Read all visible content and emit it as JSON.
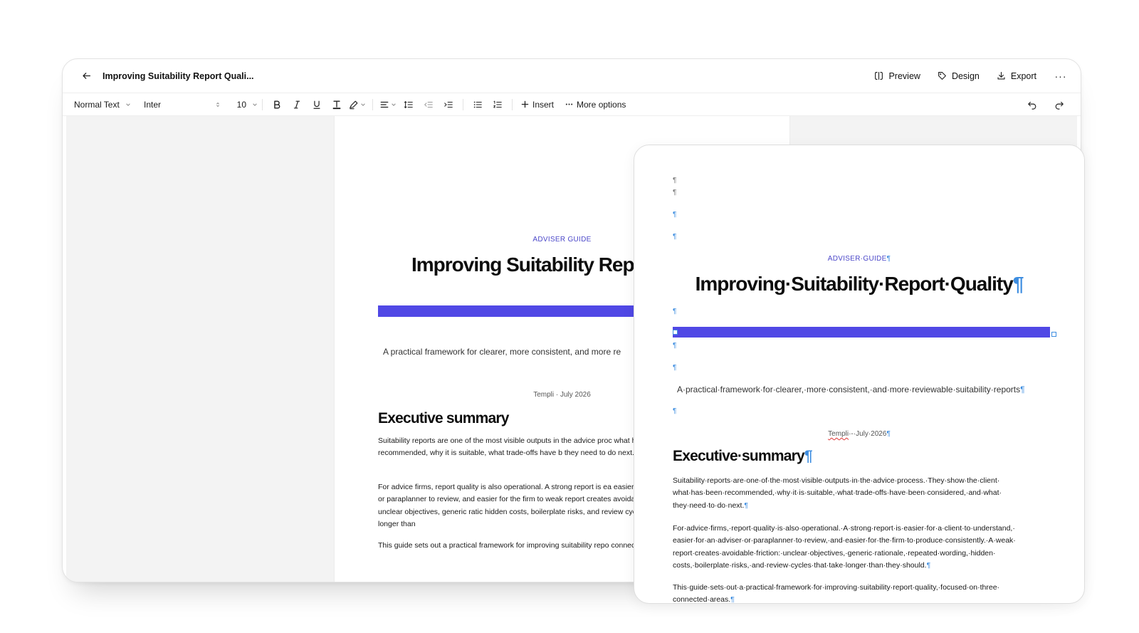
{
  "editor": {
    "doc_title": "Improving Suitability Report Quali...",
    "actions": {
      "preview": "Preview",
      "design": "Design",
      "export": "Export",
      "more": "···"
    },
    "toolbar": {
      "style": "Normal Text",
      "font": "Inter",
      "size": "10",
      "insert": "Insert",
      "more_options": "More options"
    },
    "document": {
      "kicker": "ADVISER GUIDE",
      "title": "Improving Suitability Repo",
      "subtitle": "A practical framework for clearer, more consistent, and more re",
      "byline": "Templi · July 2026",
      "heading": "Executive summary",
      "para1": "Suitability reports are one of the most visible outputs in the advice proc what has been recommended, why it is suitable, what trade-offs have b they need to do next.",
      "para2": "For advice firms, report quality is also operational. A strong report is ea easier for an adviser or paraplanner to review, and easier for the firm to weak report creates avoidable friction: unclear objectives, generic ratic hidden costs, boilerplate risks, and review cycles that take longer than",
      "para3": "This guide sets out a practical framework for improving suitability repo connected areas.",
      "accent_color": "#5048e5"
    }
  },
  "preview_card": {
    "pilcrow": "¶",
    "kicker": "ADVISER·GUIDE",
    "title": "Improving·Suitability·Report·Quality",
    "subtitle": "A·practical·framework·for·clearer,·more·consistent,·and·more·reviewable·suitability·reports",
    "byline_author": "Templi",
    "byline_rest": "·-·July·2026",
    "heading": "Executive·summary",
    "para1": "Suitability·reports·are·one·of·the·most·visible·outputs·in·the·advice·process.·They·show·the·client· what·has·been·recommended,·why·it·is·suitable,·what·trade-offs·have·been·considered,·and·what· they·need·to·do·next.",
    "para2": "For·advice·firms,·report·quality·is·also·operational.·A·strong·report·is·easier·for·a·client·to·understand,· easier·for·an·adviser·or·paraplanner·to·review,·and·easier·for·the·firm·to·produce·consistently.·A·weak· report·creates·avoidable·friction:·unclear·objectives,·generic·rationale,·repeated·wording,·hidden· costs,·boilerplate·risks,·and·review·cycles·that·take·longer·than·they·should.",
    "para3": "This·guide·sets·out·a·practical·framework·for·improving·suitability·report·quality,·focused·on·three· connected·areas.",
    "marker_color": "#3d8de0"
  }
}
